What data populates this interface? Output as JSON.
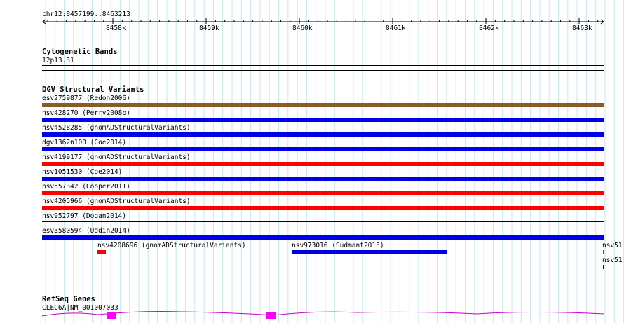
{
  "browser": {
    "position": "chr12:8457199..8463213",
    "ruler_ticks": [
      "8458k",
      "8459k",
      "8460k",
      "8461k",
      "8462k",
      "8463k"
    ]
  },
  "tracks": {
    "cytogenetic": {
      "title": "Cytogenetic Bands",
      "band": "12p13.31"
    },
    "dgv": {
      "title": "DGV Structural Variants",
      "features": [
        {
          "label": "esv2759877 (Redon2006)",
          "color": "#8b5a2b"
        },
        {
          "label": "nsv428270 (Perry2008b)",
          "color": "#0000e6"
        },
        {
          "label": "nsv4528285 (gnomADStructuralVariants)",
          "color": "#0000e6"
        },
        {
          "label": "dgv1362n100 (Coe2014)",
          "color": "#0000e6"
        },
        {
          "label": "nsv4199177 (gnomADStructuralVariants)",
          "color": "#ff0000"
        },
        {
          "label": "nsv1051530 (Coe2014)",
          "color": "#0000e6"
        },
        {
          "label": "nsv557342 (Cooper2011)",
          "color": "#ff0000"
        },
        {
          "label": "nsv4205966 (gnomADStructuralVariants)",
          "color": "#ff0000"
        },
        {
          "label": "nsv952797 (Dogan2014)",
          "color": "#000000"
        },
        {
          "label": "esv3580594 (Uddin2014)",
          "color": "#0000e6"
        }
      ],
      "small_features": [
        {
          "label": "nsv4208696 (gnomADStructuralVariants)",
          "color": "#ff0000"
        },
        {
          "label": "nsv973016 (Sudmant2013)",
          "color": "#0000e6"
        },
        {
          "label": "nsv51",
          "color": "#ff0000"
        },
        {
          "label": "nsv51",
          "color": "#0000e6"
        }
      ]
    },
    "refseq": {
      "title": "RefSeq Genes",
      "gene_label": "CLEC6A|NM_001007033",
      "intron_color": "#cc00cc",
      "exon_color": "#ff00ff"
    }
  }
}
